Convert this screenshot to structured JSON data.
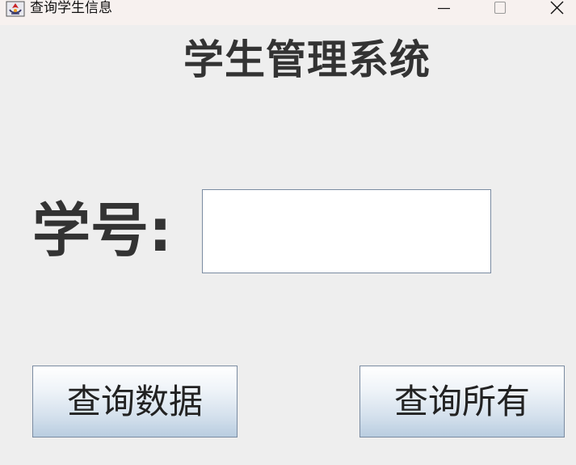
{
  "window": {
    "title": "查询学生信息",
    "icons": {
      "app": "java-app-icon",
      "minimize": "minimize-icon",
      "maximize": "maximize-icon",
      "close": "close-icon"
    }
  },
  "main": {
    "heading": "学生管理系统",
    "student_id_label": "学号:",
    "student_id_value": "",
    "query_button_label": "查询数据",
    "query_all_button_label": "查询所有"
  },
  "colors": {
    "titlebar_bg": "#f7f1ef",
    "window_bg": "#eeeeee",
    "text": "#333333",
    "border": "#7a8ba1"
  }
}
